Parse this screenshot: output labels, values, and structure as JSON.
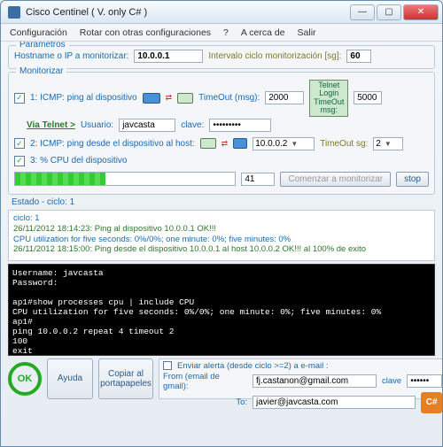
{
  "titlebar": {
    "title": "Cisco Centinel ( V. only C# )"
  },
  "menu": {
    "config": "Configuración",
    "rotar": "Rotar con otras configuraciones",
    "about_q": "?",
    "about": "A cerca de",
    "exit": "Salir"
  },
  "params": {
    "legend": "Parametros",
    "host_label": "Hostname o IP a monitorizar:",
    "host_value": "10.0.0.1",
    "interval_label": "Intervalo ciclo monitorización [sg]:",
    "interval_value": "60"
  },
  "monitor": {
    "legend": "Monitorizar",
    "item1": "1: ICMP: ping al dispositivo",
    "timeout_label": "TimeOut (msg):",
    "timeout_value": "2000",
    "via_telnet": "Via Telnet >",
    "user_label": "Usuario:",
    "user_value": "javcasta",
    "pass_label": "clave:",
    "pass_value": "•••••••••",
    "telnet_box_l1": "Telnet",
    "telnet_box_l2": "Login",
    "telnet_box_l3": "TimeOut",
    "telnet_box_l4": "msg:",
    "telnet_timeout": "5000",
    "item2": "2: ICMP: ping desde el dispositivo al host:",
    "host2_value": "10.0.0.2",
    "timeout2_label": "TimeOut sg:",
    "timeout2_value": "2",
    "item3": "3: % CPU del dispositivo"
  },
  "progress": {
    "value": "41",
    "start_btn": "Comenzar a monitorizar",
    "stop_btn": "stop"
  },
  "state": {
    "label": "Estado - ciclo: 1",
    "line1": "ciclo: 1",
    "line2": "26/11/2012 18:14:23: Ping al dispositivo 10.0.0.1 OK!!!",
    "line3": "CPU utilization for five seconds: 0%/0%; one minute: 0%; five minutes: 0%",
    "line4": "26/11/2012 18:15:00: Ping desde el dispositivo 10.0.0.1 al host 10.0.0.2 OK!!! al 100% de exito"
  },
  "terminal": {
    "l1": "Username: javcasta",
    "l2": "Password:",
    "l3": "ap1#show processes cpu | include CPU",
    "l4": "CPU utilization for five seconds: 0%/0%; one minute: 0%; five minutes: 0%",
    "l5": "ap1#",
    "l6": "ping 10.0.0.2 repeat 4 timeout 2",
    "l7": "100",
    "l8": "exit"
  },
  "bottom": {
    "ok": "OK",
    "help": "Ayuda",
    "copy": "Copiar al portapapeles",
    "alert_label": "Enviar alerta (desde ciclo >=2) a e-mail :",
    "from_label": "From (email de gmail):",
    "from_value": "fj.castanon@gmail.com",
    "to_label": "To:",
    "to_value": "javier@javcasta.com",
    "clave_label": "clave",
    "clave_value": "••••••",
    "cs": "C#"
  }
}
